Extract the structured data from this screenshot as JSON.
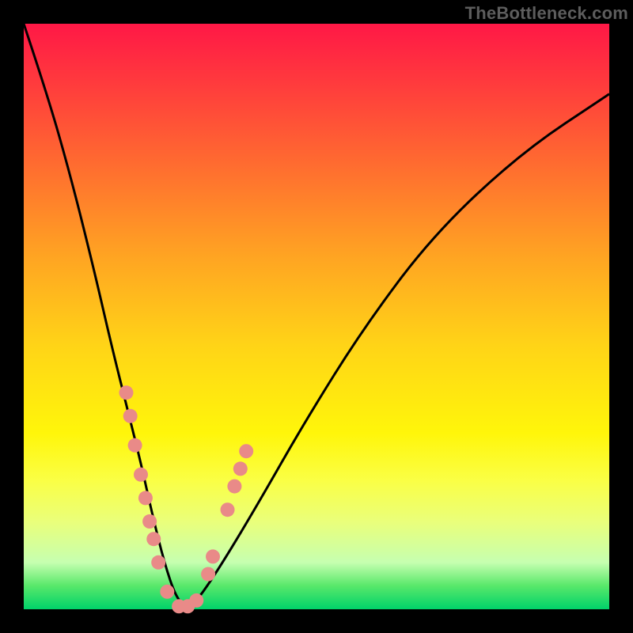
{
  "watermark": "TheBottleneck.com",
  "chart_data": {
    "type": "line",
    "title": "",
    "xlabel": "",
    "ylabel": "",
    "xlim": [
      0,
      100
    ],
    "ylim": [
      0,
      100
    ],
    "grid": false,
    "legend": false,
    "series": [
      {
        "name": "bottleneck-curve",
        "x": [
          0,
          4,
          8,
          12,
          15,
          18,
          20,
          22,
          24,
          26,
          28,
          30,
          34,
          40,
          48,
          58,
          70,
          85,
          100
        ],
        "values": [
          100,
          88,
          74,
          58,
          45,
          33,
          25,
          16,
          8,
          2,
          0,
          2,
          8,
          18,
          32,
          48,
          64,
          78,
          88
        ]
      }
    ],
    "markers": {
      "name": "highlight-dots",
      "color": "#e98a88",
      "radius": 9,
      "points": [
        {
          "x": 17.5,
          "y": 37
        },
        {
          "x": 18.2,
          "y": 33
        },
        {
          "x": 19.0,
          "y": 28
        },
        {
          "x": 20.0,
          "y": 23
        },
        {
          "x": 20.8,
          "y": 19
        },
        {
          "x": 21.5,
          "y": 15
        },
        {
          "x": 22.2,
          "y": 12
        },
        {
          "x": 23.0,
          "y": 8
        },
        {
          "x": 24.5,
          "y": 3
        },
        {
          "x": 26.5,
          "y": 0.5
        },
        {
          "x": 28.0,
          "y": 0.5
        },
        {
          "x": 29.5,
          "y": 1.5
        },
        {
          "x": 31.5,
          "y": 6
        },
        {
          "x": 32.3,
          "y": 9
        },
        {
          "x": 34.8,
          "y": 17
        },
        {
          "x": 36.0,
          "y": 21
        },
        {
          "x": 37.0,
          "y": 24
        },
        {
          "x": 38.0,
          "y": 27
        }
      ]
    }
  }
}
